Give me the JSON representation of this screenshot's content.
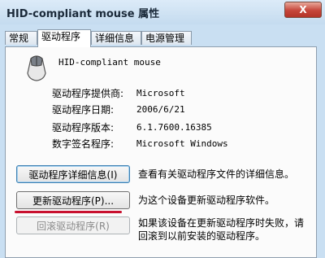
{
  "window": {
    "title": "HID-compliant mouse 属性",
    "close_label": "X"
  },
  "tabs": [
    "常规",
    "驱动程序",
    "详细信息",
    "电源管理"
  ],
  "device": {
    "name": "HID-compliant mouse"
  },
  "driver_info": [
    {
      "label": "驱动程序提供商:",
      "value": "Microsoft"
    },
    {
      "label": "驱动程序日期:",
      "value": "2006/6/21"
    },
    {
      "label": "驱动程序版本:",
      "value": "6.1.7600.16385"
    },
    {
      "label": "数字签名程序:",
      "value": "Microsoft Windows"
    }
  ],
  "actions": [
    {
      "button": "驱动程序详细信息(I)",
      "description": "查看有关驱动程序文件的详细信息。"
    },
    {
      "button": "更新驱动程序(P)...",
      "description": "为这个设备更新驱动程序软件。"
    },
    {
      "button": "回滚驱动程序(R)",
      "description": "如果该设备在更新驱动程序时失败，请回滚到以前安装的驱动程序。"
    }
  ]
}
